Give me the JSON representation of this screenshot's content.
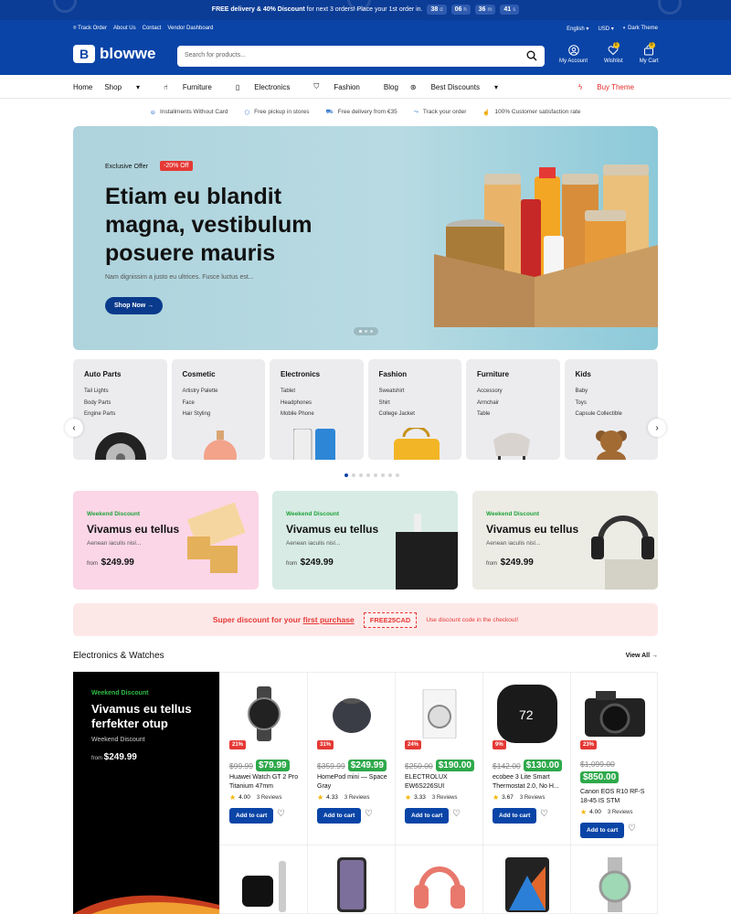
{
  "topbar": {
    "promo_bold": "FREE delivery & 40% Discount",
    "promo_rest": " for next 3 orders! Place your 1st order in.",
    "cd": [
      {
        "v": "38",
        "u": "d"
      },
      {
        "v": "06",
        "u": "h"
      },
      {
        "v": "36",
        "u": "m"
      },
      {
        "v": "41",
        "u": "s"
      }
    ]
  },
  "header": {
    "links": [
      "Track Order",
      "About Us",
      "Contact",
      "Vendor Dashboard"
    ],
    "lang": "English",
    "currency": "USD",
    "theme": "Dark Theme",
    "logo": "blowwe",
    "search_placeholder": "Search for products...",
    "account": "My Account",
    "wishlist": "Wishlist",
    "wishlist_count": "0",
    "cart": "My Cart",
    "cart_count": "0"
  },
  "nav": {
    "items": [
      "Home",
      "Shop",
      "Furniture",
      "Electronics",
      "Fashion",
      "Blog",
      "Best Discounts"
    ],
    "buy": "Buy Theme"
  },
  "features": [
    "Installments Without Card",
    "Free pickup in stores",
    "Free delivery from €35",
    "Track your order",
    "100% Customer satisfaction rate"
  ],
  "hero": {
    "exclusive": "Exclusive Offer",
    "discount": "-20% Off",
    "title": "Etiam eu blandit magna, vestibulum posuere mauris",
    "subtitle": "Nam dignissim a justo eu ultrices. Fusce luctus est...",
    "cta": "Shop Now"
  },
  "categories": [
    {
      "name": "Auto Parts",
      "items": [
        "Tail Lights",
        "Body Parts",
        "Engine Parts"
      ]
    },
    {
      "name": "Cosmetic",
      "items": [
        "Artistry Palette",
        "Face",
        "Hair Styling"
      ]
    },
    {
      "name": "Electronics",
      "items": [
        "Tablet",
        "Headphones",
        "Mobile Phone"
      ]
    },
    {
      "name": "Fashion",
      "items": [
        "Sweatshirt",
        "Shirt",
        "College Jacket"
      ]
    },
    {
      "name": "Furniture",
      "items": [
        "Accessory",
        "Armchair",
        "Table"
      ]
    },
    {
      "name": "Kids",
      "items": [
        "Baby",
        "Toys",
        "Capsule Collectible"
      ]
    }
  ],
  "banners": [
    {
      "tag": "Weekend Discount",
      "title": "Vivamus eu tellus",
      "sub": "Aenean iaculis nisl...",
      "from": "from",
      "price": "$249.99",
      "bg": "#fbd6e6"
    },
    {
      "tag": "Weekend Discount",
      "title": "Vivamus eu tellus",
      "sub": "Aenean iaculis nisl...",
      "from": "from",
      "price": "$249.99",
      "bg": "#d8ebe5"
    },
    {
      "tag": "Weekend Discount",
      "title": "Vivamus eu tellus",
      "sub": "Aenean iaculis nisl...",
      "from": "from",
      "price": "$249.99",
      "bg": "#ecebe4"
    }
  ],
  "coupon": {
    "text_a": "Super discount for your ",
    "text_b": "first purchase",
    "code": "FREE25CAD",
    "note": "Use discount code in the checkout!"
  },
  "section": {
    "title": "Electronics & Watches",
    "view_all": "View All"
  },
  "promo_card": {
    "tag": "Weekend Discount",
    "title": "Vivamus eu tellus ferfekter otup",
    "sub": "Weekend Discount",
    "from": "from",
    "price": "$249.99"
  },
  "products": [
    {
      "sale": "21%",
      "old": "$99.99",
      "new": "$79.99",
      "name": "Huawei Watch GT 2 Pro Titanium 47mm",
      "rating": "4.00",
      "reviews": "3 Reviews",
      "add": "Add to cart"
    },
    {
      "sale": "31%",
      "old": "$359.99",
      "new": "$249.99",
      "name": "HomePod mini — Space Gray",
      "rating": "4.33",
      "reviews": "3 Reviews",
      "add": "Add to cart"
    },
    {
      "sale": "24%",
      "old": "$250.00",
      "new": "$190.00",
      "name": "ELECTROLUX EW6S226SUI",
      "rating": "3.33",
      "reviews": "3 Reviews",
      "add": "Add to cart"
    },
    {
      "sale": "9%",
      "old": "$142.00",
      "new": "$130.00",
      "name": "ecobee 3 Lite Smart Thermostat 2.0, No H...",
      "rating": "3.67",
      "reviews": "3 Reviews",
      "add": "Add to cart"
    },
    {
      "sale": "23%",
      "old": "$1,099.00",
      "new": "$850.00",
      "name": "Canon EOS R10 RF-S 18-45 IS STM",
      "rating": "4.00",
      "reviews": "3 Reviews",
      "add": "Add to cart"
    }
  ]
}
